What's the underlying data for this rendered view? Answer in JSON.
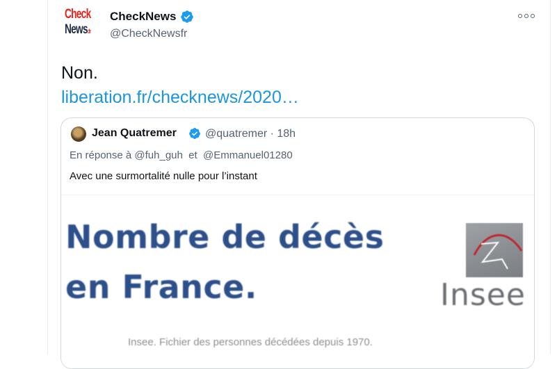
{
  "tweet": {
    "author": {
      "display_name": "CheckNews",
      "handle": "@CheckNewsfr",
      "avatar_line1": "Check",
      "avatar_line2": "News",
      "avatar_suffix": ".fr",
      "verified": true
    },
    "text": "Non.",
    "link_text": "liberation.fr/checknews/2020…",
    "colors": {
      "link": "#1b95e0",
      "verified": "#1d9bf0",
      "secondary_text": "#536471"
    }
  },
  "quoted": {
    "author_name": "Jean Quatremer",
    "handle_time": "@quatremer · 18h",
    "verified": true,
    "reply_context": "En réponse à @fuh_guh  et  @Emmanuel01280",
    "text": "Avec une surmortalité nulle pour l’instant",
    "media": {
      "title_line1": "Nombre de décès",
      "title_line2": "en France.",
      "logo_text": "Insee",
      "source": "Insee. Fichier des personnes décédées depuis 1970."
    }
  },
  "icons": {
    "verified": "verified-badge-icon",
    "more": "more-options-icon"
  }
}
